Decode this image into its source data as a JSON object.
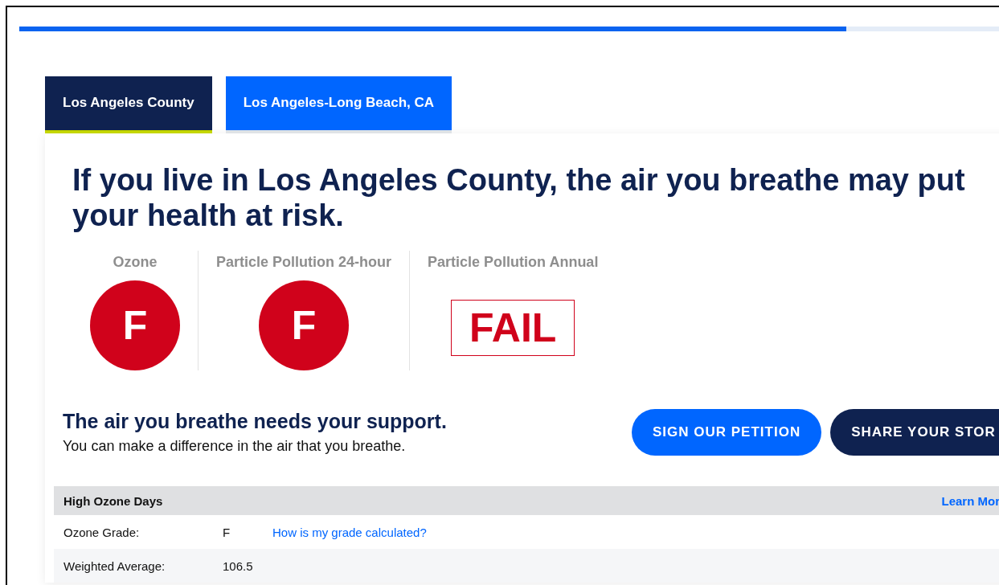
{
  "progress": {
    "level": 0.83
  },
  "tabs": [
    {
      "label": "Los Angeles County",
      "selected": true
    },
    {
      "label": "Los Angeles-Long Beach, CA",
      "selected": false
    }
  ],
  "headline": "If you live in Los Angeles County, the air you breathe may put your health at risk.",
  "grades": [
    {
      "label": "Ozone",
      "kind": "circle",
      "grade": "F"
    },
    {
      "label": "Particle Pollution 24-hour",
      "kind": "circle",
      "grade": "F"
    },
    {
      "label": "Particle Pollution Annual",
      "kind": "box",
      "grade": "FAIL"
    }
  ],
  "support": {
    "title": "The air you breathe needs your support.",
    "text": "You can make a difference in the air that you breathe.",
    "buttons": [
      {
        "label": "SIGN OUR PETITION",
        "kind": "primary"
      },
      {
        "label": "SHARE YOUR STOR",
        "kind": "secondary"
      }
    ]
  },
  "table": {
    "title": "High Ozone Days",
    "link": "Learn Mor",
    "rows": [
      {
        "label": "Ozone Grade:",
        "value": "F",
        "link": "How is my grade calculated?"
      },
      {
        "label": "Weighted Average:",
        "value": "106.5"
      }
    ]
  }
}
